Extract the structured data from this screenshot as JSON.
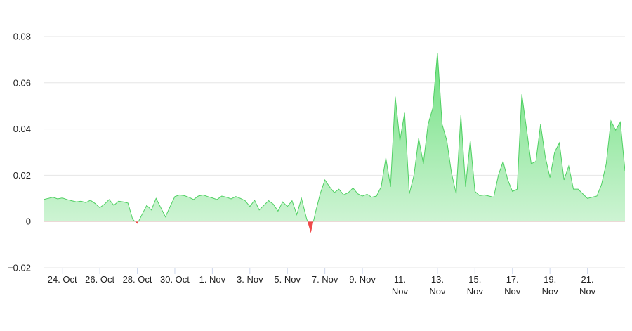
{
  "colors": {
    "positive_fill_top": "#6ee07f",
    "positive_fill_bottom": "#d4f5d9",
    "positive_line": "#4fd062",
    "negative_fill": "#f04a4a",
    "grid": "#e6e6e6",
    "axis": "#ccd6eb"
  },
  "chart_data": {
    "type": "area",
    "title": "",
    "xlabel": "",
    "ylabel": "",
    "x_axis": {
      "type": "datetime",
      "min": "2023-10-23",
      "max": "2023-11-23",
      "tick_dates": [
        "2023-10-24",
        "2023-10-26",
        "2023-10-28",
        "2023-10-30",
        "2023-11-01",
        "2023-11-03",
        "2023-11-05",
        "2023-11-07",
        "2023-11-09",
        "2023-11-11",
        "2023-11-13",
        "2023-11-15",
        "2023-11-17",
        "2023-11-19",
        "2023-11-21"
      ],
      "tick_labels": [
        [
          "24. Oct"
        ],
        [
          "26. Oct"
        ],
        [
          "28. Oct"
        ],
        [
          "30. Oct"
        ],
        [
          "1. Nov"
        ],
        [
          "3. Nov"
        ],
        [
          "5. Nov"
        ],
        [
          "7. Nov"
        ],
        [
          "9. Nov"
        ],
        [
          "11.",
          "Nov"
        ],
        [
          "13.",
          "Nov"
        ],
        [
          "15.",
          "Nov"
        ],
        [
          "17.",
          "Nov"
        ],
        [
          "19.",
          "Nov"
        ],
        [
          "21.",
          "Nov"
        ]
      ]
    },
    "y_axis": {
      "min": -0.02,
      "max": 0.08,
      "ticks": [
        -0.02,
        0,
        0.02,
        0.04,
        0.06,
        0.08
      ],
      "tick_labels": [
        "−0.02",
        "0",
        "0.02",
        "0.04",
        "0.06",
        "0.08"
      ]
    },
    "grid": true,
    "legend": "none",
    "series": [
      {
        "points": [
          [
            "2023-10-23T00:00",
            0.0095
          ],
          [
            "2023-10-23T06:00",
            0.01
          ],
          [
            "2023-10-23T12:00",
            0.0105
          ],
          [
            "2023-10-23T18:00",
            0.0098
          ],
          [
            "2023-10-24T00:00",
            0.0102
          ],
          [
            "2023-10-24T06:00",
            0.0095
          ],
          [
            "2023-10-24T12:00",
            0.009
          ],
          [
            "2023-10-24T18:00",
            0.0085
          ],
          [
            "2023-10-25T00:00",
            0.0088
          ],
          [
            "2023-10-25T06:00",
            0.0082
          ],
          [
            "2023-10-25T12:00",
            0.0092
          ],
          [
            "2023-10-25T18:00",
            0.0078
          ],
          [
            "2023-10-26T00:00",
            0.006
          ],
          [
            "2023-10-26T06:00",
            0.0075
          ],
          [
            "2023-10-26T12:00",
            0.0095
          ],
          [
            "2023-10-26T18:00",
            0.007
          ],
          [
            "2023-10-27T00:00",
            0.0088
          ],
          [
            "2023-10-27T06:00",
            0.0085
          ],
          [
            "2023-10-27T12:00",
            0.008
          ],
          [
            "2023-10-27T18:00",
            0.001
          ],
          [
            "2023-10-28T00:00",
            -0.001
          ],
          [
            "2023-10-28T06:00",
            0.003
          ],
          [
            "2023-10-28T12:00",
            0.007
          ],
          [
            "2023-10-28T18:00",
            0.005
          ],
          [
            "2023-10-29T00:00",
            0.01
          ],
          [
            "2023-10-29T06:00",
            0.006
          ],
          [
            "2023-10-29T12:00",
            0.002
          ],
          [
            "2023-10-29T18:00",
            0.0065
          ],
          [
            "2023-10-30T00:00",
            0.0108
          ],
          [
            "2023-10-30T06:00",
            0.0115
          ],
          [
            "2023-10-30T12:00",
            0.0112
          ],
          [
            "2023-10-30T18:00",
            0.0105
          ],
          [
            "2023-10-31T00:00",
            0.0095
          ],
          [
            "2023-10-31T06:00",
            0.011
          ],
          [
            "2023-10-31T12:00",
            0.0115
          ],
          [
            "2023-10-31T18:00",
            0.0108
          ],
          [
            "2023-11-01T00:00",
            0.0102
          ],
          [
            "2023-11-01T06:00",
            0.0095
          ],
          [
            "2023-11-01T12:00",
            0.011
          ],
          [
            "2023-11-01T18:00",
            0.0105
          ],
          [
            "2023-11-02T00:00",
            0.0098
          ],
          [
            "2023-11-02T06:00",
            0.0108
          ],
          [
            "2023-11-02T12:00",
            0.01
          ],
          [
            "2023-11-02T18:00",
            0.009
          ],
          [
            "2023-11-03T00:00",
            0.0065
          ],
          [
            "2023-11-03T06:00",
            0.0092
          ],
          [
            "2023-11-03T12:00",
            0.005
          ],
          [
            "2023-11-03T18:00",
            0.007
          ],
          [
            "2023-11-04T00:00",
            0.009
          ],
          [
            "2023-11-04T06:00",
            0.0075
          ],
          [
            "2023-11-04T12:00",
            0.0045
          ],
          [
            "2023-11-04T18:00",
            0.0085
          ],
          [
            "2023-11-05T00:00",
            0.0065
          ],
          [
            "2023-11-05T06:00",
            0.009
          ],
          [
            "2023-11-05T12:00",
            0.003
          ],
          [
            "2023-11-05T18:00",
            0.01
          ],
          [
            "2023-11-06T00:00",
            0.002
          ],
          [
            "2023-11-06T06:00",
            -0.005
          ],
          [
            "2023-11-06T12:00",
            0.004
          ],
          [
            "2023-11-06T18:00",
            0.012
          ],
          [
            "2023-11-07T00:00",
            0.018
          ],
          [
            "2023-11-07T06:00",
            0.015
          ],
          [
            "2023-11-07T12:00",
            0.0125
          ],
          [
            "2023-11-07T18:00",
            0.014
          ],
          [
            "2023-11-08T00:00",
            0.0115
          ],
          [
            "2023-11-08T06:00",
            0.0125
          ],
          [
            "2023-11-08T12:00",
            0.0145
          ],
          [
            "2023-11-08T18:00",
            0.012
          ],
          [
            "2023-11-09T00:00",
            0.011
          ],
          [
            "2023-11-09T06:00",
            0.0118
          ],
          [
            "2023-11-09T12:00",
            0.0105
          ],
          [
            "2023-11-09T18:00",
            0.011
          ],
          [
            "2023-11-10T00:00",
            0.015
          ],
          [
            "2023-11-10T06:00",
            0.0275
          ],
          [
            "2023-11-10T12:00",
            0.015
          ],
          [
            "2023-11-10T18:00",
            0.054
          ],
          [
            "2023-11-11T00:00",
            0.035
          ],
          [
            "2023-11-11T06:00",
            0.047
          ],
          [
            "2023-11-11T12:00",
            0.012
          ],
          [
            "2023-11-11T18:00",
            0.02
          ],
          [
            "2023-11-12T00:00",
            0.036
          ],
          [
            "2023-11-12T06:00",
            0.025
          ],
          [
            "2023-11-12T12:00",
            0.042
          ],
          [
            "2023-11-12T18:00",
            0.049
          ],
          [
            "2023-11-13T00:00",
            0.073
          ],
          [
            "2023-11-13T06:00",
            0.042
          ],
          [
            "2023-11-13T12:00",
            0.035
          ],
          [
            "2023-11-13T18:00",
            0.021
          ],
          [
            "2023-11-14T00:00",
            0.012
          ],
          [
            "2023-11-14T06:00",
            0.046
          ],
          [
            "2023-11-14T12:00",
            0.015
          ],
          [
            "2023-11-14T18:00",
            0.035
          ],
          [
            "2023-11-15T00:00",
            0.013
          ],
          [
            "2023-11-15T06:00",
            0.0112
          ],
          [
            "2023-11-15T12:00",
            0.0115
          ],
          [
            "2023-11-15T18:00",
            0.011
          ],
          [
            "2023-11-16T00:00",
            0.0105
          ],
          [
            "2023-11-16T06:00",
            0.02
          ],
          [
            "2023-11-16T12:00",
            0.026
          ],
          [
            "2023-11-16T18:00",
            0.018
          ],
          [
            "2023-11-17T00:00",
            0.013
          ],
          [
            "2023-11-17T06:00",
            0.014
          ],
          [
            "2023-11-17T12:00",
            0.055
          ],
          [
            "2023-11-17T18:00",
            0.04
          ],
          [
            "2023-11-18T00:00",
            0.025
          ],
          [
            "2023-11-18T06:00",
            0.026
          ],
          [
            "2023-11-18T12:00",
            0.042
          ],
          [
            "2023-11-18T18:00",
            0.028
          ],
          [
            "2023-11-19T00:00",
            0.019
          ],
          [
            "2023-11-19T06:00",
            0.03
          ],
          [
            "2023-11-19T12:00",
            0.034
          ],
          [
            "2023-11-19T18:00",
            0.018
          ],
          [
            "2023-11-20T00:00",
            0.024
          ],
          [
            "2023-11-20T06:00",
            0.014
          ],
          [
            "2023-11-20T12:00",
            0.014
          ],
          [
            "2023-11-20T18:00",
            0.012
          ],
          [
            "2023-11-21T00:00",
            0.01
          ],
          [
            "2023-11-21T06:00",
            0.0105
          ],
          [
            "2023-11-21T12:00",
            0.011
          ],
          [
            "2023-11-21T18:00",
            0.016
          ],
          [
            "2023-11-22T00:00",
            0.025
          ],
          [
            "2023-11-22T06:00",
            0.0435
          ],
          [
            "2023-11-22T12:00",
            0.0395
          ],
          [
            "2023-11-22T18:00",
            0.043
          ],
          [
            "2023-11-23T00:00",
            0.022
          ],
          [
            "2023-11-23T06:00",
            0.0215
          ]
        ]
      }
    ]
  }
}
